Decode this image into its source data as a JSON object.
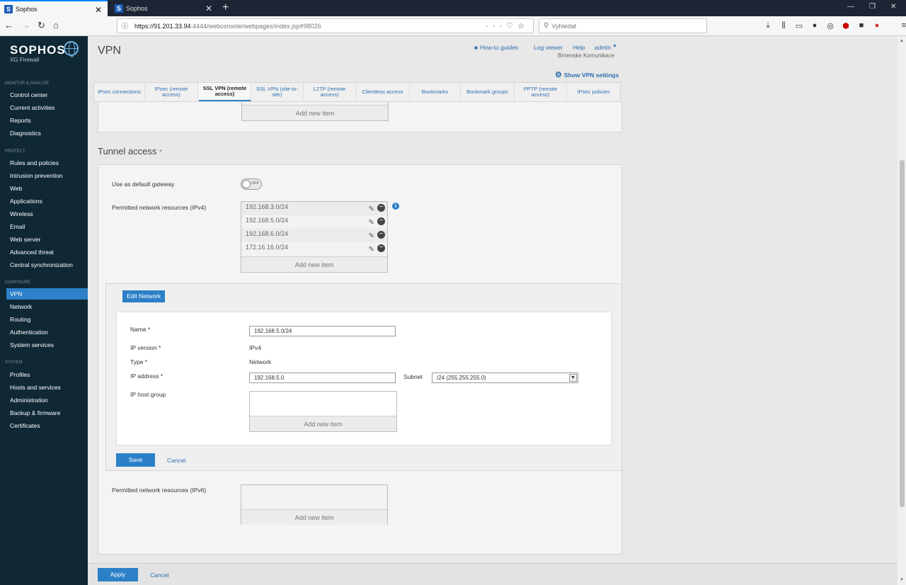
{
  "browser": {
    "tabs": [
      {
        "label": "Sophos",
        "active": true
      },
      {
        "label": "Sophos",
        "active": false
      }
    ],
    "url_host": "https://91.201.33.94",
    "url_rest": ":4444/webconsole/webpages/index.jsp#98026",
    "search_placeholder": "Vyhledat"
  },
  "sidebar": {
    "brand": "SOPHOS",
    "product": "XG Firewall",
    "sections": [
      {
        "title": "MONITOR & ANALYZE",
        "items": [
          "Control center",
          "Current activities",
          "Reports",
          "Diagnostics"
        ]
      },
      {
        "title": "PROTECT",
        "items": [
          "Rules and policies",
          "Intrusion prevention",
          "Web",
          "Applications",
          "Wireless",
          "Email",
          "Web server",
          "Advanced threat",
          "Central synchronization"
        ]
      },
      {
        "title": "CONFIGURE",
        "items": [
          "VPN",
          "Network",
          "Routing",
          "Authentication",
          "System services"
        ]
      },
      {
        "title": "SYSTEM",
        "items": [
          "Profiles",
          "Hosts and services",
          "Administration",
          "Backup & firmware",
          "Certificates"
        ]
      }
    ],
    "selected": "VPN"
  },
  "header": {
    "title": "VPN",
    "links": [
      "How-to guides",
      "Log viewer",
      "Help",
      "admin"
    ],
    "user_org": "Brnenske Komunikace",
    "vpn_settings": "Show VPN settings"
  },
  "tabs": [
    "IPsec connections",
    "IPsec (remote access)",
    "SSL VPN (remote access)",
    "SSL VPN (site-to-site)",
    "L2TP (remote access)",
    "Clientless access",
    "Bookmarks",
    "Bookmark groups",
    "PPTP (remote access)",
    "IPsec policies"
  ],
  "active_tab": "SSL VPN (remote access)",
  "tunnel": {
    "section_title": "Tunnel access",
    "required_mark": "*",
    "default_gateway_label": "Use as default gateway",
    "default_gateway_state": "OFF",
    "ipv4_label": "Permitted network resources (IPv4)",
    "ipv4_items": [
      "192.168.3.0/24",
      "192.168.5.0/24",
      "192.168.6.0/24",
      "172.16.16.0/24"
    ],
    "ipv6_label": "Permitted network resources (IPv6)",
    "add_new": "Add new item"
  },
  "dialog": {
    "title": "Edit Network",
    "name_label": "Name *",
    "name_value": "192.168.5.0/24",
    "ipversion_label": "IP version *",
    "ipversion_value": "IPv4",
    "type_label": "Type *",
    "type_value": "Network",
    "ip_label": "IP address *",
    "ip_value": "192.168.5.0",
    "subnet_label": "Subnet",
    "subnet_value": "/24 (255.255.255.0)",
    "hostgroup_label": "IP host group",
    "add_new": "Add new item",
    "save": "Save",
    "cancel": "Cancel"
  },
  "footer": {
    "apply": "Apply",
    "cancel": "Cancel"
  }
}
